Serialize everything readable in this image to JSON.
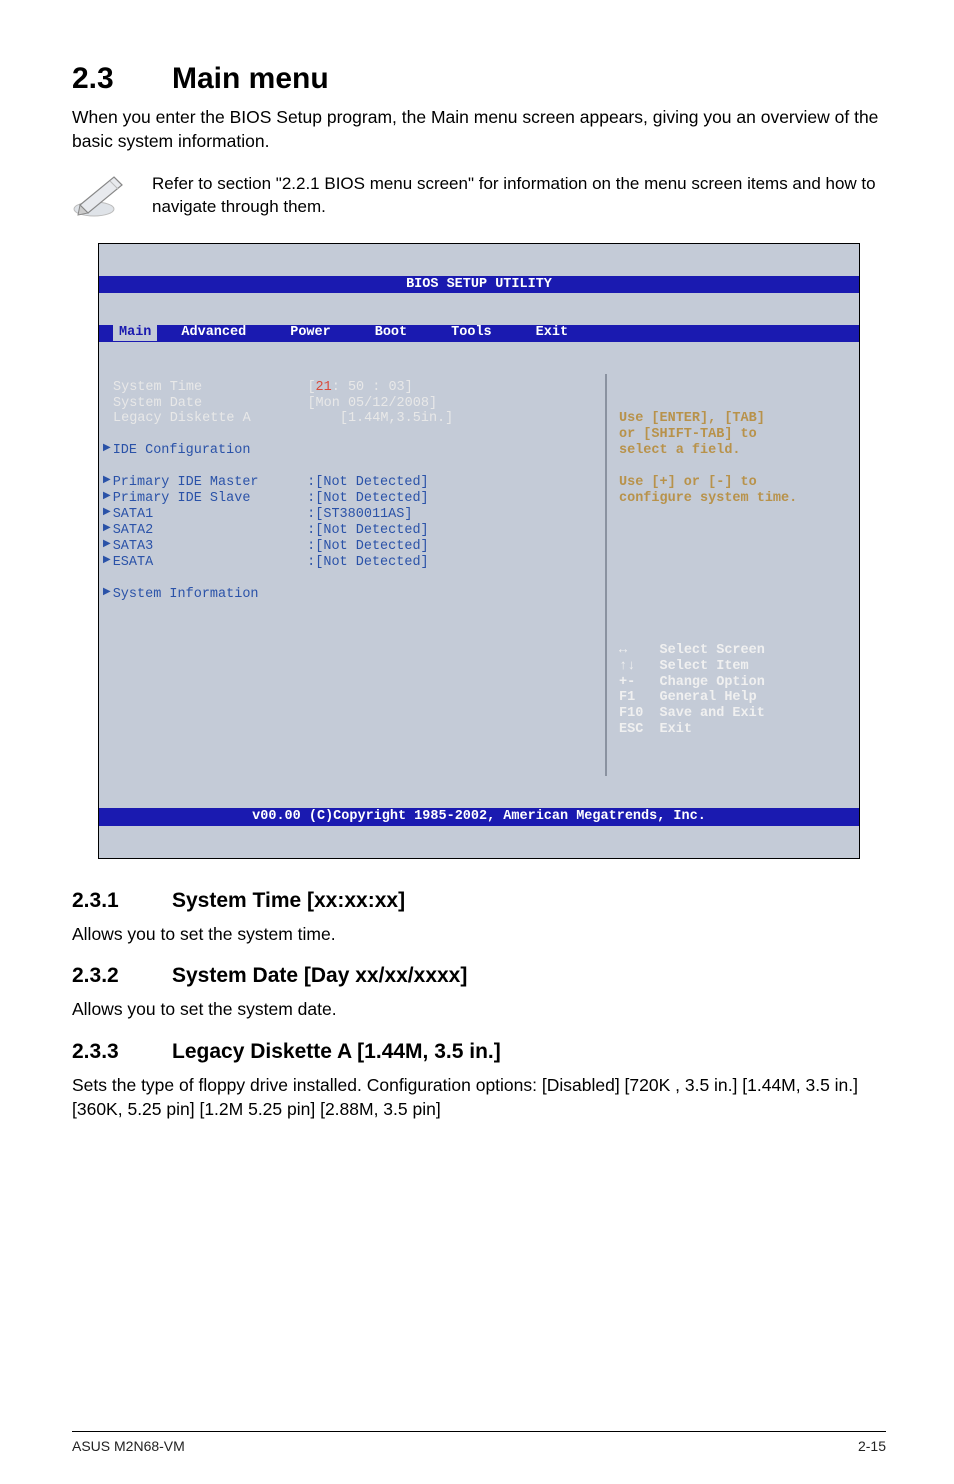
{
  "heading": {
    "num": "2.3",
    "title": "Main menu"
  },
  "intro": "When you enter the BIOS Setup program, the Main menu screen appears, giving you an overview of the basic system information.",
  "note": "Refer to section \"2.2.1 BIOS menu screen\" for information on the menu screen items and how to navigate through them.",
  "bios": {
    "title": "BIOS SETUP UTILITY",
    "tabs": [
      "Main",
      "Advanced",
      "Power",
      "Boot",
      "Tools",
      "Exit"
    ],
    "selected_tab": "Main",
    "left_items": [
      {
        "label": "System Time",
        "value": "[21: 50 : 03]",
        "white": true,
        "val_prefix_hl": "21",
        "val_rest": ": 50 : 03]"
      },
      {
        "label": "System Date",
        "value": "[Mon 05/12/2008]",
        "white": true
      },
      {
        "label": "Legacy Diskette A",
        "value": "    [1.44M,3.5in.]",
        "white": true
      },
      {
        "spacer": true
      },
      {
        "label": "IDE Configuration",
        "value": "",
        "caret": true
      },
      {
        "spacer": true
      },
      {
        "label": "Primary IDE Master",
        "value": ":[Not Detected]",
        "caret": true
      },
      {
        "label": "Primary IDE Slave",
        "value": ":[Not Detected]",
        "caret": true
      },
      {
        "label": "SATA1",
        "value": ":[ST380011AS]",
        "caret": true
      },
      {
        "label": "SATA2",
        "value": ":[Not Detected]",
        "caret": true
      },
      {
        "label": "SATA3",
        "value": ":[Not Detected]",
        "caret": true
      },
      {
        "label": "ESATA",
        "value": ":[Not Detected]",
        "caret": true
      },
      {
        "spacer": true
      },
      {
        "label": "System Information",
        "value": "",
        "caret": true
      },
      {
        "spacer": true
      },
      {
        "spacer": true
      },
      {
        "spacer": true
      }
    ],
    "right_help_top": [
      "Use [ENTER], [TAB]",
      "or [SHIFT-TAB] to",
      "select a field.",
      "",
      "Use [+] or [-] to",
      "configure system time."
    ],
    "right_keys": [
      {
        "k": "↔",
        "d": "Select Screen"
      },
      {
        "k": "↑↓",
        "d": "Select Item"
      },
      {
        "k": "+-",
        "d": "Change Option"
      },
      {
        "k": "F1",
        "d": "General Help"
      },
      {
        "k": "F10",
        "d": "Save and Exit"
      },
      {
        "k": "ESC",
        "d": "Exit"
      }
    ],
    "footer": "v00.00 (C)Copyright 1985-2002, American Megatrends, Inc."
  },
  "subsections": [
    {
      "num": "2.3.1",
      "title": "System Time [xx:xx:xx]",
      "body": "Allows you to set the system time."
    },
    {
      "num": "2.3.2",
      "title": "System Date [Day xx/xx/xxxx]",
      "body": "Allows you to set the system date."
    },
    {
      "num": "2.3.3",
      "title": "Legacy Diskette A [1.44M, 3.5 in.]",
      "body": "Sets the type of floppy drive installed. Configuration options: [Disabled] [720K , 3.5 in.] [1.44M, 3.5 in.] [360K, 5.25 pin] [1.2M 5.25 pin] [2.88M, 3.5 pin]"
    }
  ],
  "page_footer": {
    "left": "ASUS M2N68-VM",
    "right": "2-15"
  }
}
